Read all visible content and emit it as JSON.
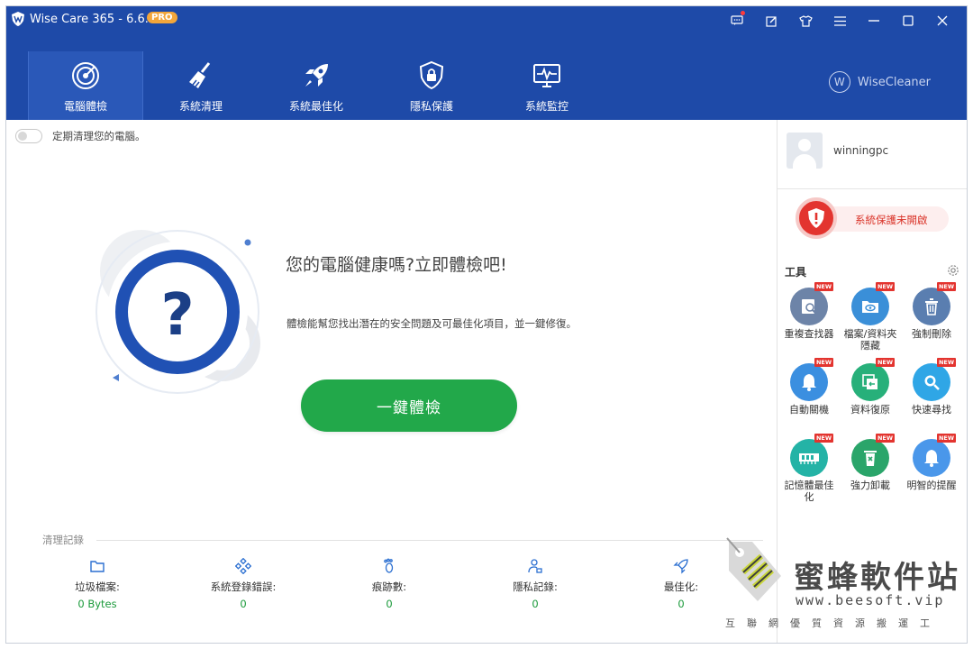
{
  "window": {
    "title": "Wise Care 365 - 6.6.2",
    "badge": "PRO"
  },
  "nav": {
    "tabs": [
      {
        "label": "電腦體檢",
        "icon": "radar-icon"
      },
      {
        "label": "系統清理",
        "icon": "broom-icon"
      },
      {
        "label": "系統最佳化",
        "icon": "rocket-icon"
      },
      {
        "label": "隱私保護",
        "icon": "lock-shield-icon"
      },
      {
        "label": "系統監控",
        "icon": "monitor-pulse-icon"
      }
    ],
    "brand": "WiseCleaner",
    "brand_mark": "W"
  },
  "main": {
    "auto_clean_label": "定期清理您的電腦。",
    "health_title": "您的電腦健康嗎?立即體檢吧!",
    "health_desc": "體檢能幫您找出潛在的安全問題及可最佳化項目，並一鍵修復。",
    "scan_button": "一鍵體檢",
    "log_title": "清理記錄",
    "stats": [
      {
        "label": "垃圾檔案:",
        "value": "0 Bytes",
        "icon": "folder-icon"
      },
      {
        "label": "系統登錄錯誤:",
        "value": "0",
        "icon": "registry-icon"
      },
      {
        "label": "痕跡數:",
        "value": "0",
        "icon": "footprint-icon"
      },
      {
        "label": "隱私記錄:",
        "value": "0",
        "icon": "user-lock-icon"
      },
      {
        "label": "最佳化:",
        "value": "0",
        "icon": "rocket-icon"
      }
    ]
  },
  "side": {
    "username": "winningpc",
    "protection_label": "系統保護未開啟",
    "tools_title": "工具",
    "new_badge": "NEW",
    "tools": [
      {
        "label": "重複查找器",
        "icon": "duplicate-finder-icon",
        "color": "#6d84a8"
      },
      {
        "label": "檔案/資料夾隱藏",
        "icon": "folder-hide-icon",
        "color": "#3a8fd8"
      },
      {
        "label": "強制刪除",
        "icon": "trash-icon",
        "color": "#5a7eb0"
      },
      {
        "label": "自動關機",
        "icon": "bell-icon",
        "color": "#3b8fe0"
      },
      {
        "label": "資料復原",
        "icon": "restore-icon",
        "color": "#27b07a"
      },
      {
        "label": "快速尋找",
        "icon": "search-icon",
        "color": "#2fa6e6"
      },
      {
        "label": "記憶體最佳化",
        "icon": "memory-icon",
        "color": "#24b3a6"
      },
      {
        "label": "強力卸載",
        "icon": "uninstall-icon",
        "color": "#2aa56a"
      },
      {
        "label": "明智的提醒",
        "icon": "reminder-icon",
        "color": "#4a97ea"
      }
    ]
  },
  "watermark": {
    "title": "蜜蜂軟件站",
    "url": "www.beesoft.vip",
    "sub": "互聯網優質資源搬運工"
  }
}
